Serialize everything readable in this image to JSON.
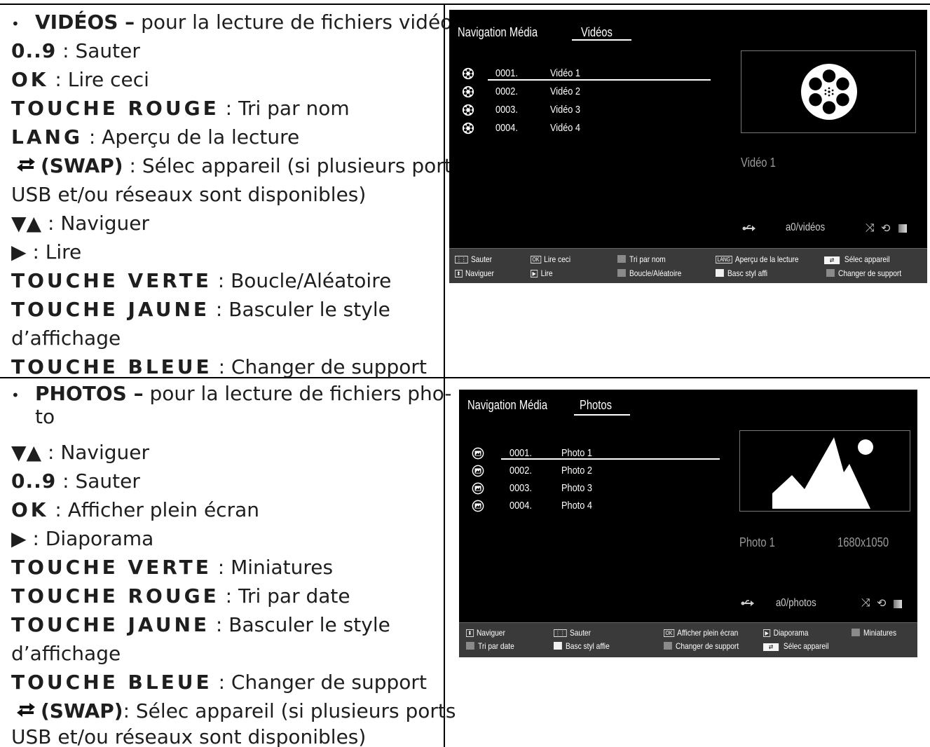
{
  "videos_section": {
    "heading_keyword": "VIDÉOS –",
    "heading_text": " pour la lecture de fichiers vidéo",
    "lines": [
      {
        "key": "0..9",
        "text": " : Sauter"
      },
      {
        "key": "OK",
        "text": " : Lire ceci"
      },
      {
        "key": "TOUCHE ROUGE",
        "text": " : Tri par nom"
      },
      {
        "key": "LANG",
        "text": " : Aperçu de la lecture"
      },
      {
        "key": "(SWAP)",
        "text": " : Sélec appareil (si plusieurs ports"
      },
      {
        "key": "",
        "text": "USB et/ou réseaux sont disponibles)"
      },
      {
        "key": "",
        "text": " : Naviguer"
      },
      {
        "key": "",
        "text": " : Lire"
      },
      {
        "key": "TOUCHE VERTE",
        "text": " : Boucle/Aléatoire"
      },
      {
        "key": "TOUCHE JAUNE",
        "text": " : Basculer le style"
      },
      {
        "key": "",
        "text": "d’affichage"
      },
      {
        "key": "TOUCHE BLEUE",
        "text": " : Changer de support"
      }
    ]
  },
  "photos_section": {
    "heading_keyword": "PHOTOS –",
    "heading_text": " pour la lecture de fichiers pho-",
    "heading_cont": "to",
    "lines": [
      {
        "key": "",
        "text": " : Naviguer"
      },
      {
        "key": "0..9",
        "text": " : Sauter"
      },
      {
        "key": "OK",
        "text": " : Afficher plein écran"
      },
      {
        "key": "",
        "text": " : Diaporama"
      },
      {
        "key": "TOUCHE VERTE",
        "text": " : Miniatures"
      },
      {
        "key": "TOUCHE ROUGE",
        "text": " : Tri par date"
      },
      {
        "key": "TOUCHE JAUNE",
        "text": " : Basculer le style"
      },
      {
        "key": "",
        "text": "d’affichage"
      },
      {
        "key": "TOUCHE BLEUE",
        "text": " : Changer de support"
      },
      {
        "key": "(SWAP)",
        "text": ": Sélec appareil (si plusieurs ports"
      },
      {
        "key": "",
        "text": "USB et/ou réseaux sont disponibles)"
      }
    ]
  },
  "video_screen": {
    "nav_title": "Navigation Média",
    "tab": "Vidéos",
    "items": [
      {
        "num": "0001.",
        "name": "Vidéo 1"
      },
      {
        "num": "0002.",
        "name": "Vidéo 2"
      },
      {
        "num": "0003.",
        "name": "Vidéo 3"
      },
      {
        "num": "0004.",
        "name": "Vidéo 4"
      }
    ],
    "selected_name": "Vidéo 1",
    "path": "a0/vidéos",
    "bar": {
      "sauter": "Sauter",
      "lire_ceci": "Lire ceci",
      "tri_nom": "Tri par nom",
      "lang_tag": "LANG",
      "apercu": "Aperçu de la lecture",
      "selec": "Sélec appareil",
      "naviguer": "Naviguer",
      "lire": "Lire",
      "boucle": "Boucle/Aléatoire",
      "basc": "Basc styl affi",
      "changer": "Changer de support",
      "ok_tag": "OK"
    }
  },
  "photo_screen": {
    "nav_title": "Navigation Média",
    "tab": "Photos",
    "items": [
      {
        "num": "0001.",
        "name": "Photo 1"
      },
      {
        "num": "0002.",
        "name": "Photo 2"
      },
      {
        "num": "0003.",
        "name": "Photo 3"
      },
      {
        "num": "0004.",
        "name": "Photo 4"
      }
    ],
    "selected_name": "Photo 1",
    "resolution": "1680x1050",
    "path": "a0/photos",
    "bar": {
      "naviguer": "Naviguer",
      "sauter": "Sauter",
      "afficher": "Afficher plein écran",
      "diaporama": "Diaporama",
      "miniatures": "Miniatures",
      "tri_date": "Tri par date",
      "basc": "Basc styl affie",
      "changer": "Changer de support",
      "selec": "Sélec appareil",
      "ok_tag": "OK"
    }
  }
}
